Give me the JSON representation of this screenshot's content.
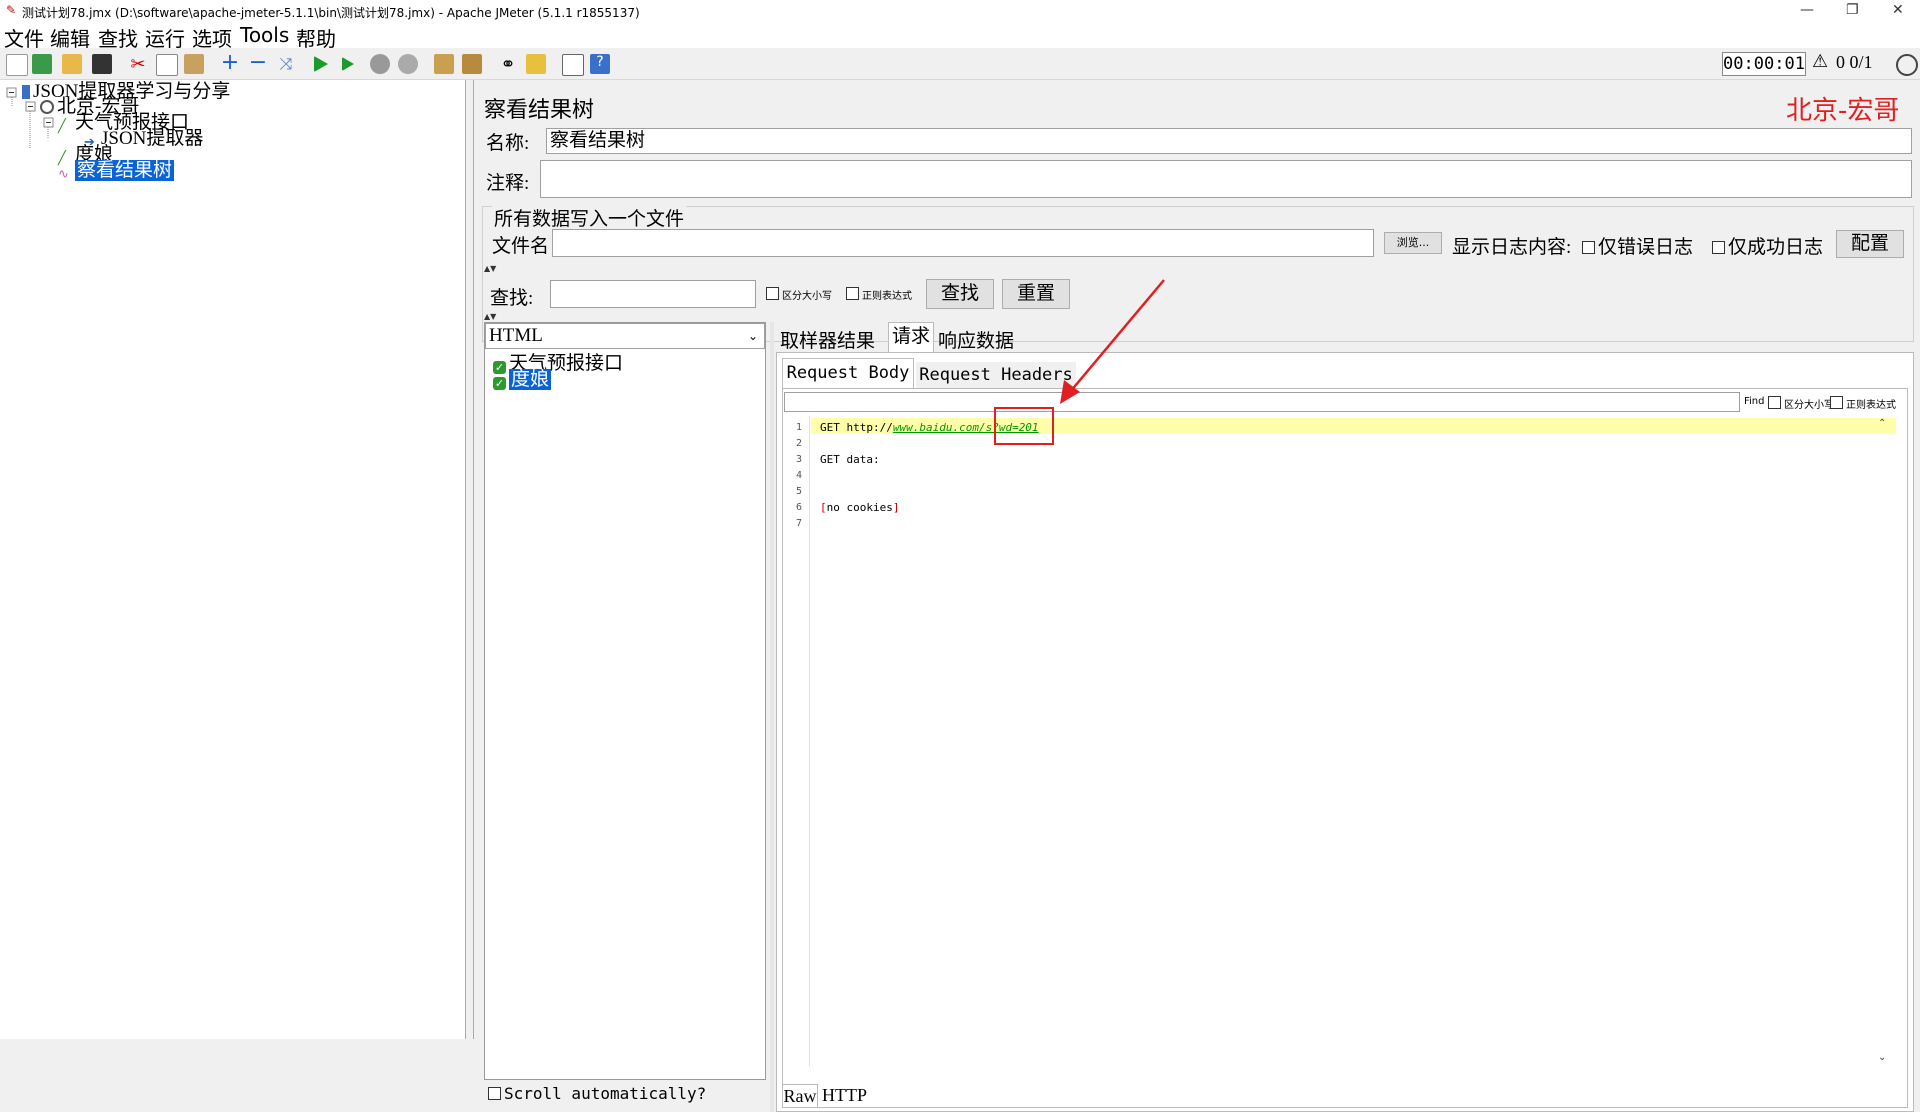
{
  "window": {
    "title": "测试计划78.jmx (D:\\software\\apache-jmeter-5.1.1\\bin\\测试计划78.jmx) - Apache JMeter (5.1.1 r1855137)",
    "minimize": "—",
    "restore": "❐",
    "close": "✕"
  },
  "menu": [
    "文件",
    "编辑",
    "查找",
    "运行",
    "选项",
    "Tools",
    "帮助"
  ],
  "toolbar": {
    "timer": "00:00:01",
    "warn_icon": "⚠",
    "counts": "0  0/1"
  },
  "tree": {
    "items": [
      {
        "label": "JSON提取器学习与分享",
        "icon": "test-plan-icon"
      },
      {
        "label": "北京-宏哥",
        "icon": "thread-group-icon"
      },
      {
        "label": "天气预报接口",
        "icon": "http-sampler-icon"
      },
      {
        "label": "JSON提取器",
        "icon": "json-extractor-icon"
      },
      {
        "label": "度娘",
        "icon": "http-sampler-icon"
      },
      {
        "label": "察看结果树",
        "icon": "listener-icon"
      }
    ]
  },
  "panel": {
    "title": "察看结果树",
    "watermark": "北京-宏哥",
    "name_label": "名称:",
    "name_value": "察看结果树",
    "comment_label": "注释:",
    "comment_value": "",
    "file_section_title": "所有数据写入一个文件",
    "file_label": "文件名",
    "file_value": "",
    "browse_button": "浏览...",
    "log_label": "显示日志内容:",
    "errors_only": "仅错误日志",
    "success_only": "仅成功日志",
    "config_button": "配置",
    "search_label": "查找:",
    "search_value": "",
    "case_sensitive": "区分大小写",
    "regex": "正则表达式",
    "find_button": "查找",
    "reset_button": "重置"
  },
  "results": {
    "renderer": "HTML",
    "samples": [
      "天气预报接口",
      "度娘"
    ],
    "scroll_auto": "Scroll automatically?",
    "tabs": [
      "取样器结果",
      "请求",
      "响应数据"
    ],
    "subtabs": [
      "Request Body",
      "Request Headers"
    ],
    "find_label": "Find",
    "find_case": "区分大小写",
    "find_regex": "正则表达式",
    "bottom_tabs": [
      "Raw",
      "HTTP"
    ],
    "code": {
      "line_numbers": [
        "1",
        "2",
        "3",
        "4",
        "5",
        "6",
        "7"
      ],
      "get_prefix": "GET http://",
      "get_url": "www.baidu.com/s?wd=201",
      "get_data": "GET data:",
      "no_cookies": "[no cookies]"
    }
  },
  "colors": {
    "selection": "#0a64d6",
    "annotation_red": "#e02020",
    "highlight_line": "#ffffaa",
    "url_green": "#009900"
  }
}
